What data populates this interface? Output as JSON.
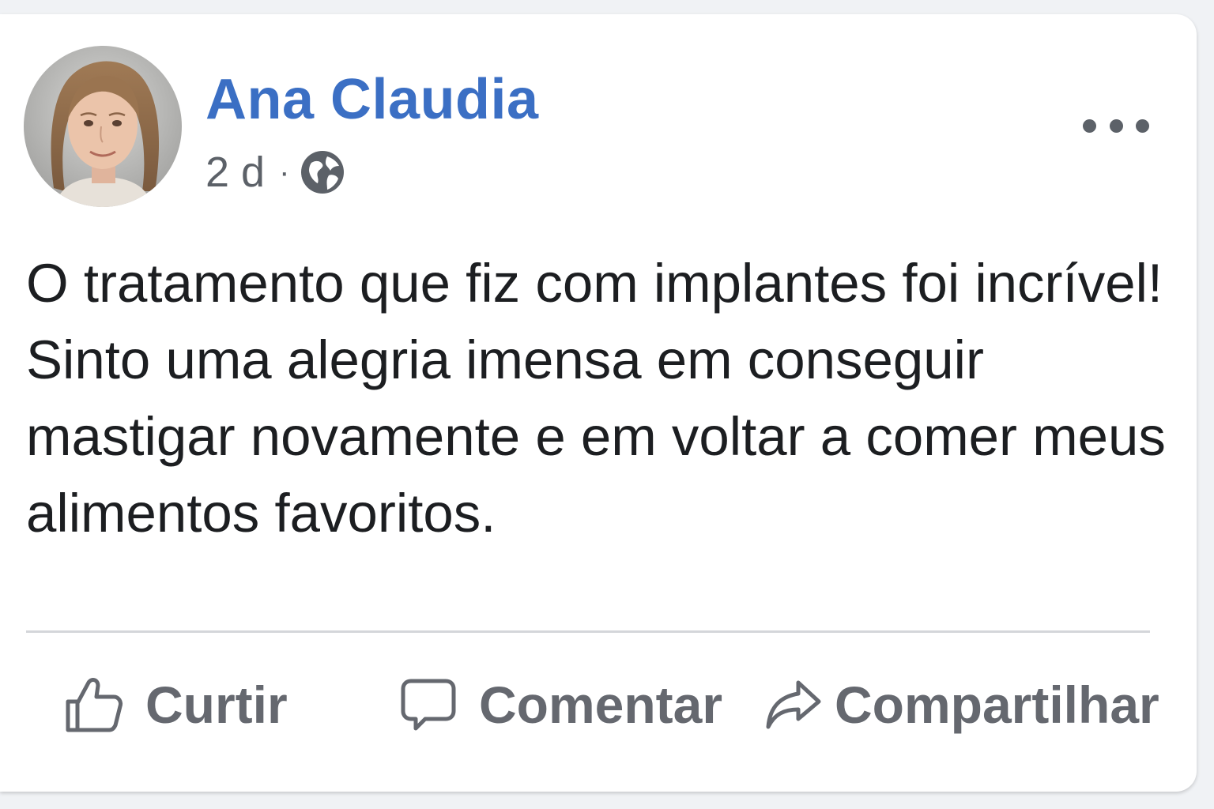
{
  "post": {
    "author": "Ana Claudia",
    "time": "2 d",
    "separator": "·",
    "privacy_icon": "globe-icon",
    "more_icon": "more-options-icon",
    "text": "O tratamento que fiz com implantes foi incrível! Sinto uma alegria imensa em conseguir mastigar novamente e em voltar a comer meus alimentos favoritos.",
    "avatar": "profile-photo"
  },
  "actions": {
    "like": {
      "label": "Curtir",
      "icon": "thumbs-up-icon"
    },
    "comment": {
      "label": "Comentar",
      "icon": "comment-bubble-icon"
    },
    "share": {
      "label": "Compartilhar",
      "icon": "share-arrow-icon"
    }
  },
  "colors": {
    "author_name": "#3b6fc4",
    "body_text": "#1c1e21",
    "secondary_text": "#65686f",
    "background": "#f0f2f5",
    "card": "#ffffff"
  }
}
